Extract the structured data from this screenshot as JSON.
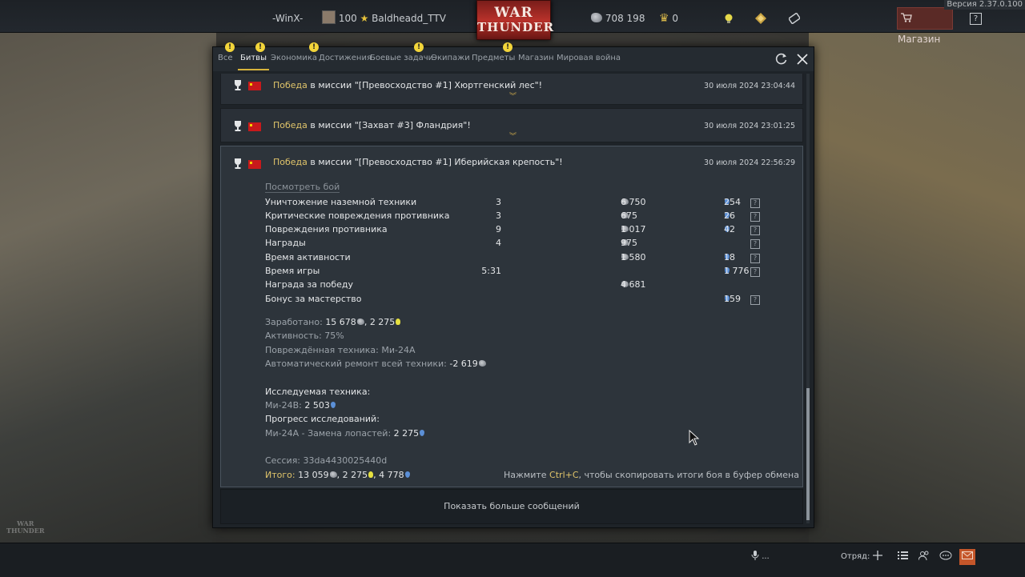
{
  "topbar": {
    "version": "Версия 2.37.0.100",
    "squad_tag": "-WinX-",
    "level": "100",
    "nickname": "Baldheadd_TTV",
    "logo_line1": "WAR",
    "logo_line2": "THUNDER",
    "silver_lions": "708 198",
    "golden_eagles": "0",
    "shop_label": "Магазин",
    "help_label": "?"
  },
  "dialog": {
    "tabs": [
      {
        "label": "Все",
        "alert": true
      },
      {
        "label": "Битвы",
        "alert": true,
        "active": true
      },
      {
        "label": "Экономика",
        "alert": false
      },
      {
        "label": "Достижения",
        "alert": true
      },
      {
        "label": "Боевые задачи",
        "alert": false
      },
      {
        "label": "Экипажи",
        "alert": true
      },
      {
        "label": "Предметы",
        "alert": false
      },
      {
        "label": "Магазин",
        "alert": true
      },
      {
        "label": "Мировая война",
        "alert": false
      }
    ],
    "alert_mark": "!",
    "messages": [
      {
        "win": "Победа",
        "text": " в миссии \"[Превосходство #1] Хюртгенский лес\"!",
        "date": "30 июля 2024 23:04:44"
      },
      {
        "win": "Победа",
        "text": " в миссии \"[Захват #3] Фландрия\"!",
        "date": "30 июля 2024 23:01:25"
      },
      {
        "win": "Победа",
        "text": " в миссии \"[Превосходство #1] Иберийская крепость\"!",
        "date": "30 июля 2024 22:56:29"
      }
    ],
    "watch_battle": "Посмотреть бой",
    "stats": [
      {
        "name": "Уничтожение наземной техники",
        "count": "3",
        "sl": "6 750",
        "rp": "254",
        "help": true
      },
      {
        "name": "Критические повреждения противника",
        "count": "3",
        "sl": "675",
        "rp": "26",
        "help": true
      },
      {
        "name": "Повреждения противника",
        "count": "9",
        "sl": "1 017",
        "rp": "42",
        "help": true
      },
      {
        "name": "Награды",
        "count": "4",
        "sl": "975",
        "rp": "",
        "help": true
      },
      {
        "name": "Время активности",
        "count": "",
        "sl": "1 580",
        "rp": "18",
        "help": true
      },
      {
        "name": "Время игры",
        "count": "5:31",
        "sl": "",
        "rp": "1 776",
        "help": true
      },
      {
        "name": "Награда за победу",
        "count": "",
        "sl": "4 681",
        "rp": "",
        "help": false
      },
      {
        "name": "Бонус за мастерство",
        "count": "",
        "sl": "",
        "rp": "159",
        "help": true
      }
    ],
    "earned_label": "Заработано: ",
    "earned_sl": "15 678",
    "earned_sep": ", ",
    "earned_rp": "2 275",
    "activity": "Активность: 75%",
    "damaged_label": "Повреждённая техника: ",
    "damaged_value": "Ми-24А",
    "repair_label": "Автоматический ремонт всей техники: ",
    "repair_value": "-2 619",
    "research_label": "Исследуемая техника:",
    "research_item_label": "Ми-24В: ",
    "research_item_value": "2 503",
    "progress_label": "Прогресс исследований:",
    "progress_item_label": "Ми-24А - Замена лопастей: ",
    "progress_item_value": "2 275",
    "session": "Сессия: 33da4430025440d",
    "total_label": "Итого: ",
    "total_sl": "13 059",
    "total_sep1": ", ",
    "total_rp1": "2 275",
    "total_sep2": ", ",
    "total_rp2": "4 778",
    "copy_hint_pre": "Нажмите ",
    "copy_hint_key": "Ctrl+C",
    "copy_hint_post": ", чтобы скопировать итоги боя в буфер обмена",
    "show_more": "Показать больше сообщений"
  },
  "bottombar": {
    "voice": "...",
    "squad_label": "Отряд:"
  },
  "corner_logo": [
    "WAR",
    "THUNDER"
  ],
  "colors": {
    "accent_gold": "#e0c46a",
    "alert_yellow": "#f3d53a",
    "logo_red": "#b7312a",
    "rp_blue": "#5b8fd6"
  }
}
